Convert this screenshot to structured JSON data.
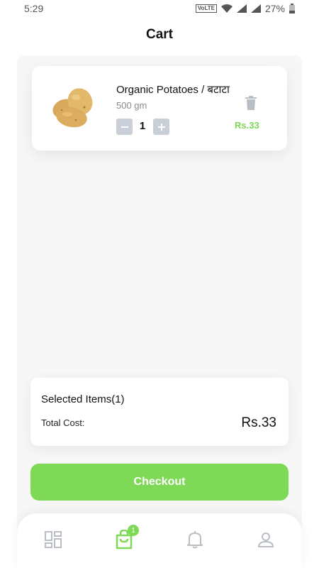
{
  "status_bar": {
    "time": "5:29",
    "network_badge": "VoLTE",
    "battery": "27%"
  },
  "header": {
    "title": "Cart"
  },
  "cart": {
    "items": [
      {
        "name": "Organic Potatoes / बटाटा",
        "weight": "500 gm",
        "quantity": "1",
        "price": "Rs.33",
        "image_icon": "potatoes-image",
        "delete_icon": "trash-icon"
      }
    ]
  },
  "summary": {
    "title": "Selected Items(1)",
    "total_label": "Total Cost:",
    "total_value": "Rs.33"
  },
  "checkout": {
    "label": "Checkout"
  },
  "bottom_nav": {
    "items": [
      {
        "icon": "dashboard-icon"
      },
      {
        "icon": "shopping-bag-icon",
        "badge": "1"
      },
      {
        "icon": "bell-icon"
      },
      {
        "icon": "user-icon"
      }
    ]
  },
  "colors": {
    "accent": "#7ed957",
    "icon_gray": "#b9bec4",
    "qty_button": "#c9cfd6"
  }
}
